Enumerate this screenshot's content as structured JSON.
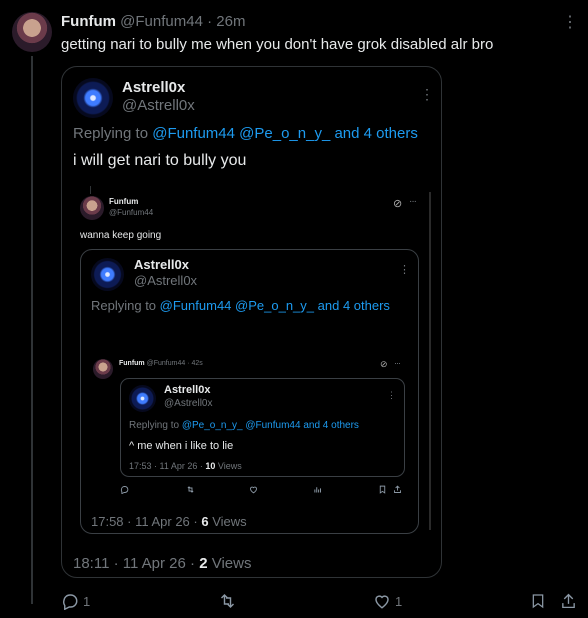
{
  "tweet": {
    "author_name": "Funfum",
    "author_handle": "@Funfum44",
    "time": "26m",
    "text": "getting nari to bully me when you don't have grok disabled alr bro",
    "actions": {
      "reply_count": "1",
      "like_count": "1"
    }
  },
  "quote": {
    "author_name": "Astrell0x",
    "author_handle": "@Astrell0x",
    "replying_prefix": "Replying to",
    "mention_1": "@Funfum44",
    "mention_2": "@Pe_o_n_y_",
    "mention_rest": "and 4 others",
    "text": "i will get nari to bully you",
    "meta": "18:11 · 11 Apr 26 · ",
    "views_count": "2",
    "views_label": " Views"
  },
  "screenshot": {
    "author_name": "Funfum",
    "author_handle": "@Funfum44",
    "text": "wanna keep going",
    "quote": {
      "author_name": "Astrell0x",
      "author_handle": "@Astrell0x",
      "replying_prefix": "Replying to",
      "mention_1": "@Funfum44",
      "mention_2": "@Pe_o_n_y_",
      "mention_rest": "and 4 others",
      "meta": "17:58 · 11 Apr 26 · ",
      "views_count": "6",
      "views_label": " Views"
    },
    "nested": {
      "author_name": "Funfum",
      "author_handle": "@Funfum44 · 42s",
      "quote": {
        "author_name": "Astrell0x",
        "author_handle": "@Astrell0x",
        "replying_prefix": "Replying to",
        "mention_1": "@Pe_o_n_y_",
        "mention_2": "@Funfum44",
        "mention_rest": "and 4 others",
        "text": "^ me when i like to lie",
        "meta": "17:53 · 11 Apr 26 · ",
        "views_count": "10",
        "views_label": " Views"
      }
    }
  },
  "colors": {
    "background": "#000000",
    "text": "#e7e9ea",
    "muted": "#71767b",
    "link": "#1d9bf0",
    "border": "#2f3336"
  }
}
